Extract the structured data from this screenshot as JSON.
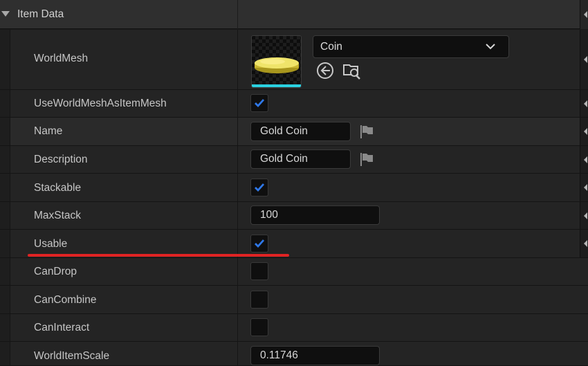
{
  "category": {
    "title": "Item Data"
  },
  "rows": {
    "world_mesh": {
      "label": "WorldMesh",
      "selected": "Coin",
      "thumbnail_icon": "coin-mesh-thumbnail",
      "use_selected_icon": "use-selected-arrow-icon",
      "browse_icon": "browse-folder-search-icon"
    },
    "use_world_mesh": {
      "label": "UseWorldMeshAsItemMesh",
      "checked": true
    },
    "name": {
      "label": "Name",
      "value": "Gold Coin",
      "icon": "flag-icon"
    },
    "description": {
      "label": "Description",
      "value": "Gold Coin",
      "icon": "flag-icon"
    },
    "stackable": {
      "label": "Stackable",
      "checked": true
    },
    "max_stack": {
      "label": "MaxStack",
      "value": "100"
    },
    "usable": {
      "label": "Usable",
      "checked": true
    },
    "can_drop": {
      "label": "CanDrop",
      "checked": false
    },
    "can_combine": {
      "label": "CanCombine",
      "checked": false
    },
    "can_interact": {
      "label": "CanInteract",
      "checked": false
    },
    "world_item_scale": {
      "label": "WorldItemScale",
      "value": "0.11746"
    }
  },
  "colors": {
    "accent_check": "#2f78e8",
    "highlight_underline": "#e02323",
    "thumb_underline": "#2ad0e0"
  }
}
